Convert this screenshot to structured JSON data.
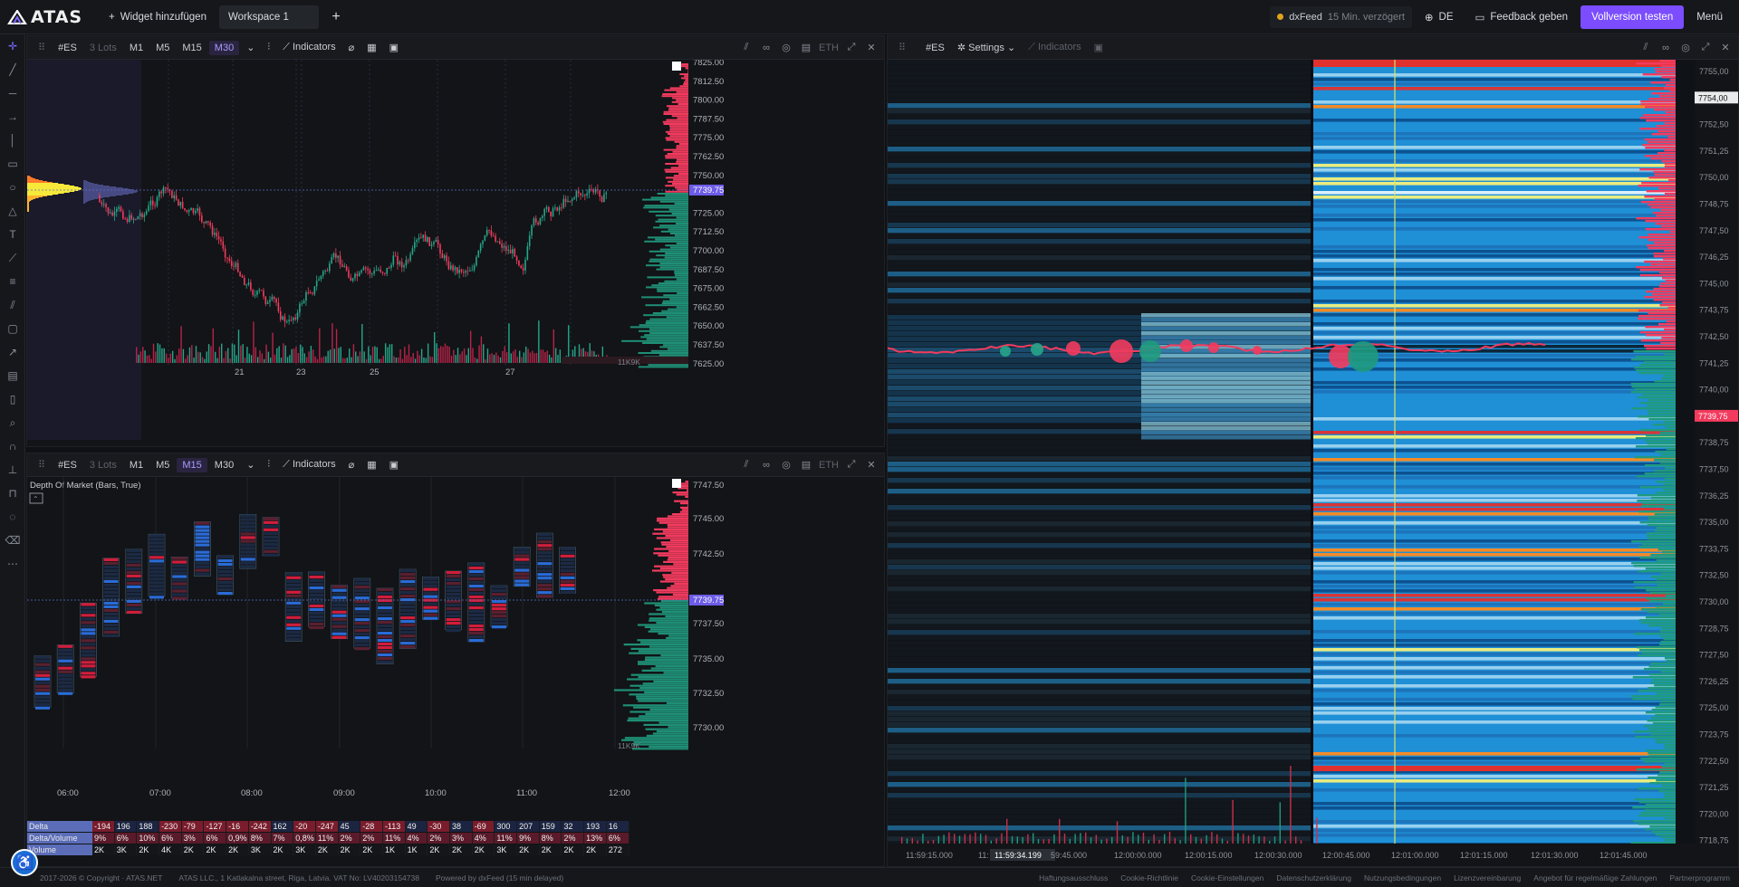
{
  "topbar": {
    "logo_text": "ATAS",
    "add_widget": "Widget hinzufügen",
    "workspace_tab": "Workspace 1",
    "feed_name": "dxFeed",
    "feed_delay": "15 Min. verzögert",
    "language": "DE",
    "feedback": "Feedback geben",
    "upgrade": "Vollversion testen",
    "menu": "Menü"
  },
  "chart1": {
    "symbol": "#ES",
    "lots": "3 Lots",
    "timeframes": [
      "M1",
      "M5",
      "M15",
      "M30"
    ],
    "selected_tf": "M30",
    "indicators": "Indicators",
    "session": "ETH",
    "price_labels": [
      "7825.00",
      "7812.50",
      "7800.00",
      "7787.50",
      "7775.00",
      "7762.50",
      "7750.00",
      "7739.75",
      "7725.00",
      "7712.50",
      "7700.00",
      "7687.50",
      "7675.00",
      "7662.50",
      "7650.00",
      "7637.50",
      "7625.00"
    ],
    "current_price": "7739.75",
    "date_labels": [
      "21",
      "23",
      "25",
      "27"
    ],
    "volume_label": "11K9K"
  },
  "chart2": {
    "symbol": "#ES",
    "lots": "3 Lots",
    "timeframes": [
      "M1",
      "M5",
      "M15",
      "M30"
    ],
    "selected_tf": "M15",
    "indicators": "Indicators",
    "session": "ETH",
    "title": "Depth Of Market (Bars, True)",
    "price_labels": [
      "7747.50",
      "7745.00",
      "7742.50",
      "7739.75",
      "7737.50",
      "7735.00",
      "7732.50",
      "7730.00"
    ],
    "current_price": "7739.75",
    "time_labels": [
      "06:00",
      "07:00",
      "08:00",
      "09:00",
      "10:00",
      "11:00",
      "12:00"
    ],
    "volume_label": "11K9K",
    "stats": {
      "delta_label": "Delta",
      "dv_label": "Delta/Volume",
      "vol_label": "Volume",
      "delta": [
        "-194",
        "196",
        "188",
        "-230",
        "-79",
        "-127",
        "-16",
        "-242",
        "162",
        "-20",
        "-247",
        "45",
        "-28",
        "-113",
        "49",
        "-30",
        "38",
        "-69",
        "300",
        "207",
        "159",
        "32",
        "193",
        "16"
      ],
      "delta_volume": [
        "9%",
        "6%",
        "10%",
        "6%",
        "3%",
        "6%",
        "0,9%",
        "8%",
        "7%",
        "0,8%",
        "11%",
        "2%",
        "2%",
        "11%",
        "4%",
        "2%",
        "3%",
        "4%",
        "11%",
        "9%",
        "8%",
        "2%",
        "13%",
        "6%"
      ],
      "volume": [
        "2K",
        "3K",
        "2K",
        "4K",
        "2K",
        "2K",
        "2K",
        "3K",
        "2K",
        "3K",
        "2K",
        "2K",
        "2K",
        "1K",
        "1K",
        "2K",
        "2K",
        "2K",
        "3K",
        "2K",
        "2K",
        "2K",
        "2K",
        "272"
      ]
    }
  },
  "heatmap": {
    "symbol": "#ES",
    "settings": "Settings",
    "indicators": "Indicators",
    "price_labels": [
      "7755,00",
      "7754,00",
      "7752,50",
      "7751,25",
      "7750,00",
      "7748,75",
      "7747,50",
      "7746,25",
      "7745,00",
      "7743,75",
      "7742,50",
      "7741,25",
      "7740,00",
      "7739,75",
      "7738,75",
      "7737,50",
      "7736,25",
      "7735,00",
      "7733,75",
      "7732,50",
      "7730,00",
      "7728,75",
      "7727,50",
      "7726,25",
      "7725,00",
      "7723,75",
      "7722,50",
      "7721,25",
      "7720,00",
      "7718,75"
    ],
    "highlight_price": "7754,00",
    "current_price": "7739,75",
    "time_labels": [
      "11:59:15.000",
      "11:",
      "11:59:34.199",
      "59:45.000",
      "12:00:00.000",
      "12:00:15.000",
      "12:00:30.000",
      "12:00:45.000",
      "12:01:00.000",
      "12:01:15.000",
      "12:01:30.000",
      "12:01:45.000"
    ]
  },
  "footer": {
    "copyright": "2017-2026 © Copyright · ATAS.NET",
    "company": "ATAS LLC., 1 Katlakalna street, Riga, Latvia. VAT No: LV40203154738",
    "powered": "Powered by dxFeed (15 min delayed)",
    "links": [
      "Haftungsausschluss",
      "Cookie-Richtlinie",
      "Cookie-Einstellungen",
      "Datenschutzerklärung",
      "Nutzungsbedingungen",
      "Lizenzvereinbarung",
      "Angebot für regelmäßige Zahlungen",
      "Partnerprogramm"
    ]
  },
  "colors": {
    "accent": "#7b4dff",
    "bull": "#26a68a",
    "bear": "#f23b5e",
    "price_tag": "#6c5ce7"
  }
}
